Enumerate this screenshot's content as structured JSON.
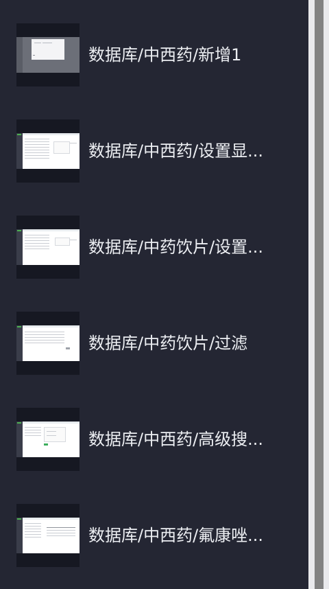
{
  "items": [
    {
      "label": "数据库/中西药/新增1",
      "thumb": "modal"
    },
    {
      "label": "数据库/中西药/设置显...",
      "thumb": "table"
    },
    {
      "label": "数据库/中药饮片/设置...",
      "thumb": "table"
    },
    {
      "label": "数据库/中药饮片/过滤",
      "thumb": "filter"
    },
    {
      "label": "数据库/中西药/高级搜...",
      "thumb": "search"
    },
    {
      "label": "数据库/中西药/氟康唑...",
      "thumb": "list"
    }
  ],
  "colors": {
    "panel_bg": "#242633",
    "thumb_bg": "#161822",
    "text": "#eceef2",
    "scrollbar_thumb": "#828282",
    "scrollbar_track": "#e9e9ec"
  }
}
